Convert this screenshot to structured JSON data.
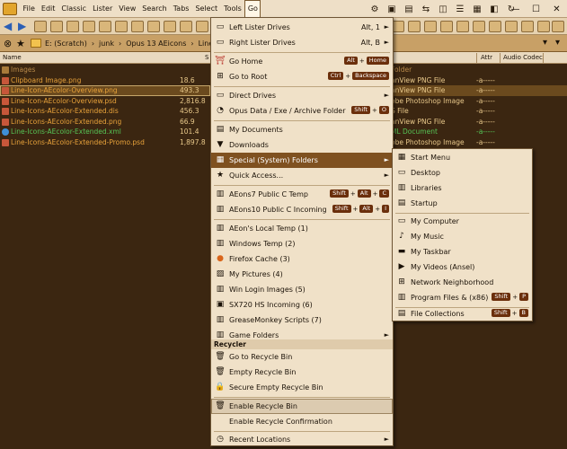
{
  "menubar": {
    "items": [
      "File",
      "Edit",
      "Classic",
      "Lister",
      "View",
      "Search",
      "Tabs",
      "Select",
      "Tools",
      "Go"
    ]
  },
  "window": {
    "minimize": "—",
    "maximize": "☐",
    "close": "✕"
  },
  "breadcrumb": {
    "parts": [
      "E: (Scratch)",
      "junk",
      "Opus 13 AEicons",
      "Line-Ic"
    ]
  },
  "columns": {
    "name": "Name",
    "attr": "Attr",
    "audio_codec": "Audio Codec",
    "size_sort": "S"
  },
  "files": [
    {
      "name": "Images",
      "size": "",
      "type": "Folder",
      "attr": "",
      "color": "#b98a4a",
      "icon": "folder-icon",
      "selected": false
    },
    {
      "name": "Clipboard Image.png",
      "size": "18.6",
      "type": "anView PNG File",
      "attr": "-a-----",
      "color": "#e8a23a",
      "icon": "png-image-icon",
      "selected": false
    },
    {
      "name": "Line-Icon-AEcolor-Overview.png",
      "size": "493.3",
      "type": "anView PNG File",
      "attr": "-a-----",
      "color": "#e8a23a",
      "icon": "png-image-icon",
      "selected": true
    },
    {
      "name": "Line-Icon-AEcolor-Overview.psd",
      "size": "2,816.8",
      "type": "obe Photoshop Image",
      "attr": "-a-----",
      "color": "#e8a23a",
      "icon": "psd-file-icon",
      "selected": false
    },
    {
      "name": "Line-Icons-AEcolor-Extended.dis",
      "size": "456.3",
      "type": "S File",
      "attr": "-a-----",
      "color": "#e8a23a",
      "icon": "dis-file-icon",
      "selected": false
    },
    {
      "name": "Line-Icons-AEcolor-Extended.png",
      "size": "66.9",
      "type": "anView PNG File",
      "attr": "-a-----",
      "color": "#e8a23a",
      "icon": "png-image-icon",
      "selected": false
    },
    {
      "name": "Line-Icons-AEcolor-Extended.xml",
      "size": "101.4",
      "type": "ML Document",
      "attr": "-a-----",
      "color": "#56c456",
      "icon": "browser-icon",
      "selected": false
    },
    {
      "name": "Line-Icons-AEcolor-Extended-Promo.psd",
      "size": "1,897.8",
      "type": "obe Photoshop Image",
      "attr": "-a-----",
      "color": "#e8a23a",
      "icon": "psd-file-icon",
      "selected": false
    }
  ],
  "go_menu": {
    "left_lister": {
      "label": "Left Lister Drives",
      "shortcut": "Alt, 1"
    },
    "right_lister": {
      "label": "Right Lister Drives",
      "shortcut": "Alt, B"
    },
    "go_home": {
      "label": "Go Home",
      "keys": [
        "Alt",
        "Home"
      ]
    },
    "go_root": {
      "label": "Go to Root",
      "keys": [
        "Ctrl",
        "Backspace"
      ]
    },
    "direct_drives": {
      "label": "Direct Drives"
    },
    "opus_data": {
      "label": "Opus Data / Exe / Archive  Folder",
      "keys": [
        "Shift",
        "O"
      ]
    },
    "my_documents": {
      "label": "My Documents"
    },
    "downloads": {
      "label": "Downloads"
    },
    "special_folders": {
      "label": "Special (System) Folders"
    },
    "quick_access": {
      "label": "Quick Access..."
    },
    "aeons7_temp": {
      "label": "AEons7 Public C Temp",
      "keys": [
        "Shift",
        "Alt",
        "C"
      ]
    },
    "aeons10_incoming": {
      "label": "AEons10 Public C Incoming",
      "keys": [
        "Shift",
        "Alt",
        "I"
      ]
    },
    "local_temp": {
      "label": "AEon's Local Temp (1)"
    },
    "windows_temp": {
      "label": "Windows Temp (2)"
    },
    "firefox_cache": {
      "label": "Firefox Cache (3)"
    },
    "my_pictures": {
      "label": "My Pictures (4)"
    },
    "win_login": {
      "label": "Win Login Images (5)"
    },
    "sx720": {
      "label": "SX720 HS Incoming (6)"
    },
    "greasemonkey": {
      "label": "GreaseMonkey Scripts (7)"
    },
    "game_folders": {
      "label": "Game Folders"
    },
    "recycler_header": "Recycler",
    "go_recycle": {
      "label": "Go to Recycle Bin"
    },
    "empty_recycle": {
      "label": "Empty Recycle Bin"
    },
    "secure_empty": {
      "label": "Secure Empty Recycle Bin"
    },
    "enable_recycle": {
      "label": "Enable Recycle Bin"
    },
    "enable_confirm": {
      "label": "Enable Recycle Confirmation"
    },
    "recent_locations": {
      "label": "Recent Locations"
    }
  },
  "special_menu": {
    "start_menu": "Start Menu",
    "desktop": "Desktop",
    "libraries": "Libraries",
    "startup": "Startup",
    "my_computer": "My Computer",
    "my_music": "My Music",
    "my_taskbar": "My Taskbar",
    "my_videos": "My Videos (Ansel)",
    "network": "Network Neighborhood",
    "program_files": {
      "label": "Program Files & (x86)",
      "keys": [
        "Shift",
        "P"
      ]
    },
    "file_collections": {
      "label": "File Collections",
      "keys": [
        "Shift",
        "B"
      ]
    }
  },
  "icons": {
    "submenu_arrow": "►",
    "plus": "+"
  }
}
